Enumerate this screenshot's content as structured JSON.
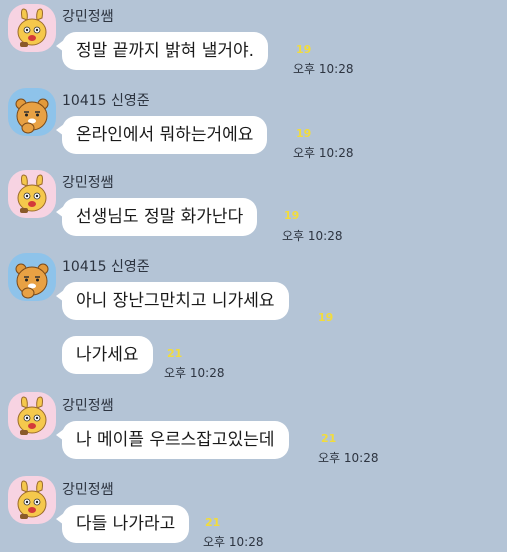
{
  "senders": {
    "teacher": "강민정쌤",
    "student": "10415 신영준"
  },
  "messages": [
    {
      "text": "정말 끝까지 밝혀 낼거야.",
      "unread": "19",
      "time": "오후 10:28"
    },
    {
      "text": "온라인에서 뭐하는거에요",
      "unread": "19",
      "time": "오후 10:28"
    },
    {
      "text": "선생님도 정말 화가난다",
      "unread": "19",
      "time": "오후 10:28"
    },
    {
      "text": "아니 장난그만치고 니가세요",
      "unread": "19",
      "time": ""
    },
    {
      "text": "나가세요",
      "unread": "21",
      "time": "오후 10:28"
    },
    {
      "text": "나 메이플 우르스잡고있는데",
      "unread": "21",
      "time": "오후 10:28"
    },
    {
      "text": "다들 나가라고",
      "unread": "21",
      "time": "오후 10:28"
    }
  ],
  "colors": {
    "background": "#b4c4d6",
    "bubble": "#ffffff",
    "unread": "#f2dc3c"
  },
  "icons": {
    "teacher_avatar": "muzi-avatar-icon",
    "student_avatar": "ryan-avatar-icon"
  }
}
